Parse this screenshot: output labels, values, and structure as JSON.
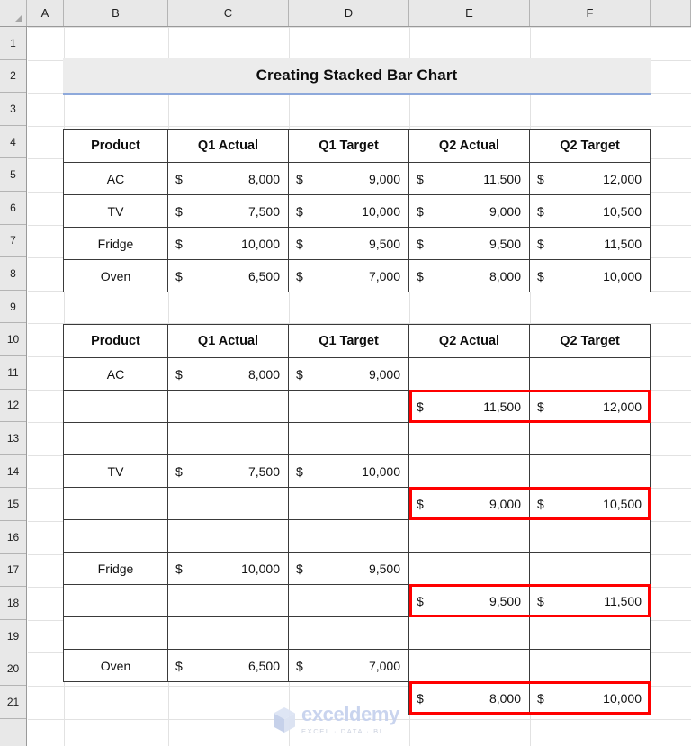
{
  "app": {
    "type": "spreadsheet",
    "column_headers": [
      "A",
      "B",
      "C",
      "D",
      "E",
      "F"
    ],
    "row_headers": [
      "1",
      "2",
      "3",
      "4",
      "5",
      "6",
      "7",
      "8",
      "9",
      "10",
      "11",
      "12",
      "13",
      "14",
      "15",
      "16",
      "17",
      "18",
      "19",
      "20",
      "21"
    ]
  },
  "title_banner": {
    "text": "Creating Stacked Bar Chart",
    "background": "#ECECEC",
    "accent_border": "#8EA9DB"
  },
  "colors": {
    "header_product": "#D4E6B5",
    "header_actual": "#FBD87F",
    "header_target": "#FBDFD0",
    "highlight_border": "#FF0000",
    "grid_border": "#3A3A3A"
  },
  "table_source": {
    "name": "source-data-table",
    "headers": [
      "Product",
      "Q1 Actual",
      "Q1 Target",
      "Q2 Actual",
      "Q2 Target"
    ],
    "rows": [
      {
        "product": "AC",
        "q1_actual": "8,000",
        "q1_target": "9,000",
        "q2_actual": "11,500",
        "q2_target": "12,000"
      },
      {
        "product": "TV",
        "q1_actual": "7,500",
        "q1_target": "10,000",
        "q2_actual": "9,000",
        "q2_target": "10,500"
      },
      {
        "product": "Fridge",
        "q1_actual": "10,000",
        "q1_target": "9,500",
        "q2_actual": "9,500",
        "q2_target": "11,500"
      },
      {
        "product": "Oven",
        "q1_actual": "6,500",
        "q1_target": "7,000",
        "q2_actual": "8,000",
        "q2_target": "10,000"
      }
    ],
    "currency_symbol": "$"
  },
  "table_staggered": {
    "name": "staggered-data-table",
    "headers": [
      "Product",
      "Q1 Actual",
      "Q1 Target",
      "Q2 Actual",
      "Q2 Target"
    ],
    "currency_symbol": "$",
    "rows": [
      {
        "row": "11",
        "product": "AC",
        "q1_actual": "8,000",
        "q1_target": "9,000",
        "q2_actual": "",
        "q2_target": "",
        "highlighted": false
      },
      {
        "row": "12",
        "product": "",
        "q1_actual": "",
        "q1_target": "",
        "q2_actual": "11,500",
        "q2_target": "12,000",
        "highlighted": true
      },
      {
        "row": "13",
        "product": "",
        "q1_actual": "",
        "q1_target": "",
        "q2_actual": "",
        "q2_target": "",
        "highlighted": false
      },
      {
        "row": "14",
        "product": "TV",
        "q1_actual": "7,500",
        "q1_target": "10,000",
        "q2_actual": "",
        "q2_target": "",
        "highlighted": false
      },
      {
        "row": "15",
        "product": "",
        "q1_actual": "",
        "q1_target": "",
        "q2_actual": "9,000",
        "q2_target": "10,500",
        "highlighted": true
      },
      {
        "row": "16",
        "product": "",
        "q1_actual": "",
        "q1_target": "",
        "q2_actual": "",
        "q2_target": "",
        "highlighted": false
      },
      {
        "row": "17",
        "product": "Fridge",
        "q1_actual": "10,000",
        "q1_target": "9,500",
        "q2_actual": "",
        "q2_target": "",
        "highlighted": false
      },
      {
        "row": "18",
        "product": "",
        "q1_actual": "",
        "q1_target": "",
        "q2_actual": "9,500",
        "q2_target": "11,500",
        "highlighted": true
      },
      {
        "row": "19",
        "product": "",
        "q1_actual": "",
        "q1_target": "",
        "q2_actual": "",
        "q2_target": "",
        "highlighted": false
      },
      {
        "row": "20",
        "product": "Oven",
        "q1_actual": "6,500",
        "q1_target": "7,000",
        "q2_actual": "",
        "q2_target": "",
        "highlighted": false
      },
      {
        "row": "21",
        "product": "",
        "q1_actual": "",
        "q1_target": "",
        "q2_actual": "8,000",
        "q2_target": "10,000",
        "highlighted": true
      }
    ]
  },
  "watermark": {
    "name": "exceldemy",
    "tagline": "EXCEL · DATA · BI"
  }
}
